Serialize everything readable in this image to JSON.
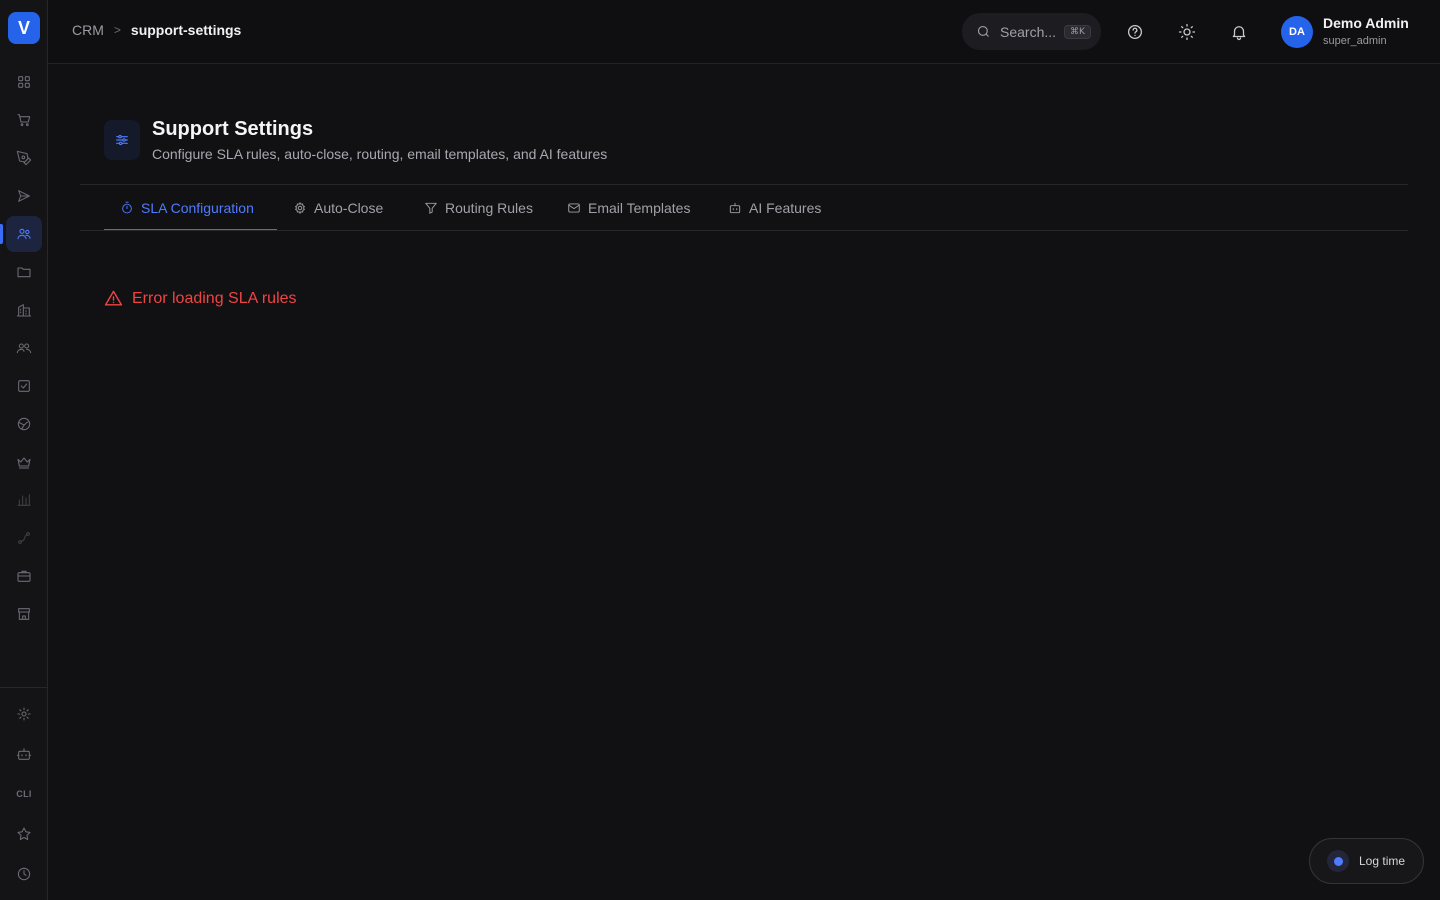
{
  "brand": {
    "logo_letter": "V",
    "accent": "#2563eb"
  },
  "sidebar": {
    "items": [
      {
        "icon": "grid-icon"
      },
      {
        "icon": "cart-icon"
      },
      {
        "icon": "pen-tool-icon"
      },
      {
        "icon": "send-icon"
      },
      {
        "icon": "users-icon",
        "active": true
      },
      {
        "icon": "folder-icon"
      },
      {
        "icon": "building-icon"
      },
      {
        "icon": "team-icon"
      },
      {
        "icon": "checkbox-icon"
      },
      {
        "icon": "globe-icon"
      },
      {
        "icon": "crown-icon"
      },
      {
        "icon": "bar-chart-icon"
      },
      {
        "icon": "route-icon"
      },
      {
        "icon": "briefcase-icon"
      },
      {
        "icon": "store-icon"
      }
    ],
    "bottom_items": [
      {
        "icon": "gear-icon"
      },
      {
        "icon": "bot-icon"
      },
      {
        "icon": "cli-icon",
        "label": "CLI"
      },
      {
        "icon": "star-icon"
      },
      {
        "icon": "clock-icon"
      }
    ]
  },
  "header": {
    "breadcrumb": {
      "root": "CRM",
      "separator": ">",
      "current": "support-settings"
    },
    "search": {
      "placeholder": "Search...",
      "shortcut": "⌘K"
    },
    "user": {
      "initials": "DA",
      "name": "Demo Admin",
      "role": "super_admin"
    }
  },
  "page": {
    "title": "Support Settings",
    "subtitle": "Configure SLA rules, auto-close, routing, email templates, and AI features",
    "tabs": [
      {
        "label": "SLA Configuration",
        "icon": "timer-icon",
        "active": true
      },
      {
        "label": "Auto-Close",
        "icon": "settings-icon"
      },
      {
        "label": "Routing Rules",
        "icon": "filter-icon"
      },
      {
        "label": "Email Templates",
        "icon": "mail-icon"
      },
      {
        "label": "AI Features",
        "icon": "bot-icon"
      }
    ],
    "error_message": "Error loading SLA rules",
    "error_color": "#ef4444"
  },
  "log_time": {
    "label": "Log time"
  }
}
